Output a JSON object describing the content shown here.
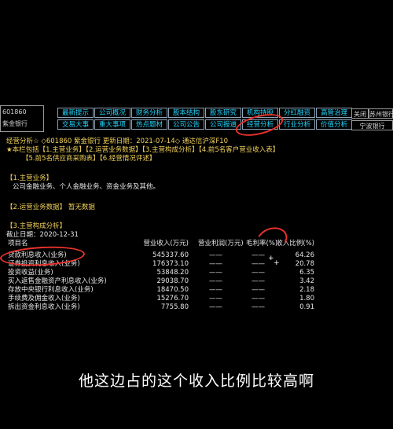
{
  "stock": {
    "code": "601860",
    "name": "紫金银行"
  },
  "tabs_row1": [
    "最新提示",
    "公司概况",
    "财务分析",
    "股本结构",
    "股东研究",
    "机构持股",
    "分红融资",
    "高管治理"
  ],
  "tabs_row2": [
    "交易大事",
    "重大事项",
    "热点题材",
    "公司公告",
    "公司报道",
    "经营分析",
    "行业分析",
    "价值分析"
  ],
  "side_buttons": {
    "close": "关闭",
    "next": "苏州银行",
    "prev": "宁波银行"
  },
  "header_line": "经营分析☆ ◇601860 紫金银行 更新日期：2021-07-14◇ 通达信沪深F10",
  "index_line1": "★本栏包括【1.主营业务】【2.运营业务数据】【3.主营构成分析】【4.前5名客户营业收入表】",
  "index_line2": "【5.前5名供应商采购表】【6.经营情况评述】",
  "section1_title": "【1.主营业务】",
  "section1_body": "公司金融业务、个人金融业务、资金业务及其他。",
  "section2_title": "【2.运营业务数据】 暂无数据",
  "section3_title": "【3.主营构成分析】",
  "cutoff_date": "截止日期：2020-12-31",
  "table_headers": {
    "name": "项目名",
    "revenue": "营业收入(万元)",
    "profit": "营业利润(万元)",
    "gross_margin": "毛利率(%)",
    "ratio": "收入比例(%)"
  },
  "table_rows": [
    {
      "name": "贷款利息收入(业务)",
      "revenue": "545337.60",
      "profit": "——",
      "gross_margin": "——",
      "ratio": "64.26"
    },
    {
      "name": "证券投资利息收入(业务)",
      "revenue": "176373.10",
      "profit": "——",
      "gross_margin": "——",
      "ratio": "20.78"
    },
    {
      "name": "投资收益(业务)",
      "revenue": "53848.20",
      "profit": "——",
      "gross_margin": "——",
      "ratio": "6.35"
    },
    {
      "name": "买入返售金融资产利息收入(业务)",
      "revenue": "29038.70",
      "profit": "——",
      "gross_margin": "——",
      "ratio": "3.42"
    },
    {
      "name": "存放中央银行利息收入(业务)",
      "revenue": "18470.50",
      "profit": "——",
      "gross_margin": "——",
      "ratio": "2.18"
    },
    {
      "name": "手续费及佣金收入(业务)",
      "revenue": "15276.70",
      "profit": "——",
      "gross_margin": "——",
      "ratio": "1.80"
    },
    {
      "name": "拆出资金利息收入(业务)",
      "revenue": "7755.80",
      "profit": "——",
      "gross_margin": "——",
      "ratio": "0.91"
    }
  ],
  "subtitle": "他这边占的这个收入比例比较高啊",
  "colors": {
    "tab_text": "#23d6ff",
    "yellow": "#f3d25a",
    "annotation_red": "#e8322b"
  }
}
